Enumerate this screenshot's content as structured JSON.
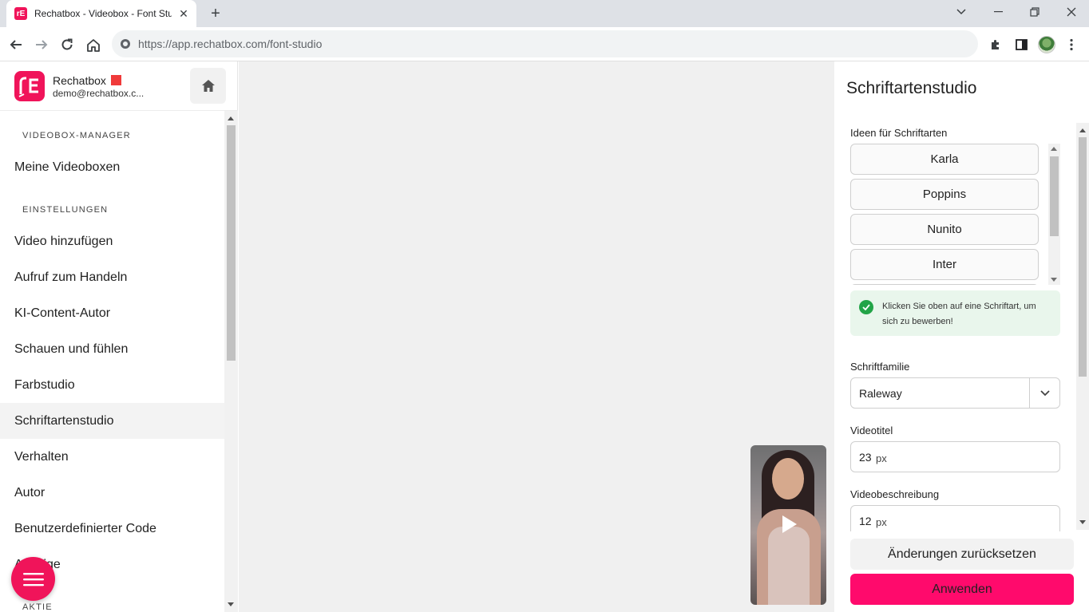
{
  "browser": {
    "tab_title": "Rechatbox - Videobox - Font Studio",
    "tab_favicon_text": "rE",
    "url_host": "https://app.rechatbox.com",
    "url_path": "/font-studio",
    "icons": {
      "back": "arrow-left-icon",
      "forward": "arrow-right-icon",
      "reload": "reload-icon",
      "home": "home-icon",
      "site_info": "site-info-icon",
      "extensions": "puzzle-icon",
      "side_panel": "side-panel-icon",
      "profile": "profile-avatar",
      "menu": "kebab-menu-icon"
    }
  },
  "sidebar": {
    "brand": "Rechatbox",
    "email": "demo@rechatbox.c...",
    "sections": [
      {
        "title": "VIDEOBOX-MANAGER",
        "items": [
          "Meine Videoboxen"
        ]
      },
      {
        "title": "EINSTELLUNGEN",
        "items": [
          "Video hinzufügen",
          "Aufruf zum Handeln",
          "KI-Content-Autor",
          "Schauen und fühlen",
          "Farbstudio",
          "Schriftartenstudio",
          "Verhalten",
          "Autor",
          "Benutzerdefinierter Code",
          "Anzeige"
        ]
      },
      {
        "title": "AKTIE",
        "items": []
      }
    ],
    "active_item": "Schriftartenstudio"
  },
  "panel": {
    "title": "Schriftartenstudio",
    "ideas_label": "Ideen für Schriftarten",
    "font_ideas": [
      "Karla",
      "Poppins",
      "Nunito",
      "Inter",
      ""
    ],
    "notice": "Klicken Sie oben auf eine Schriftart, um sich zu bewerben!",
    "family_label": "Schriftfamilie",
    "family_value": "Raleway",
    "title_size_label": "Videotitel",
    "title_size_value": "23",
    "description_size_label": "Videobeschreibung",
    "description_size_value": "12",
    "unit": "px",
    "reset_label": "Änderungen zurücksetzen",
    "apply_label": "Anwenden"
  },
  "colors": {
    "brand": "#f0145a",
    "apply": "#ff0a6c",
    "success": "#22a447",
    "notice_bg": "#e9f6ec"
  }
}
